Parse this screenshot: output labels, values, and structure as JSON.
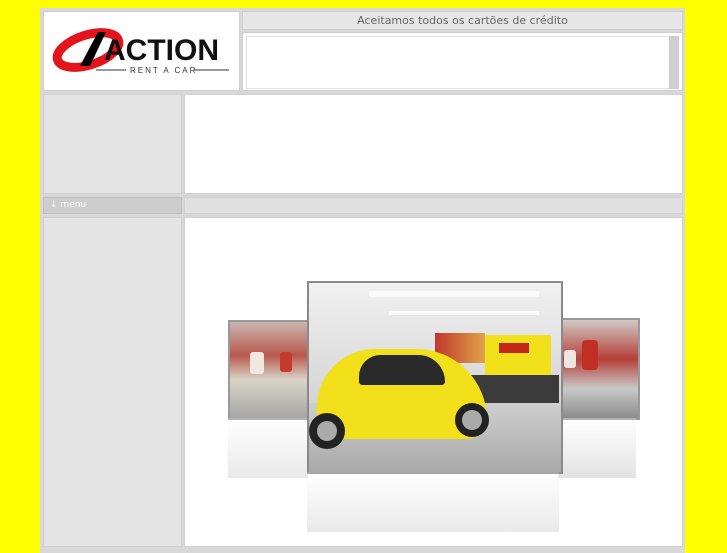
{
  "logo": {
    "brand_text": "ACTION",
    "tagline": "RENT A CAR"
  },
  "header": {
    "notice": "Aceitamos todos os cartões de crédito"
  },
  "nav": {
    "menu_label": "menu"
  },
  "colors": {
    "page_background": "#ffff00",
    "logo_red": "#e3141b",
    "car_yellow": "#f2e01a"
  }
}
